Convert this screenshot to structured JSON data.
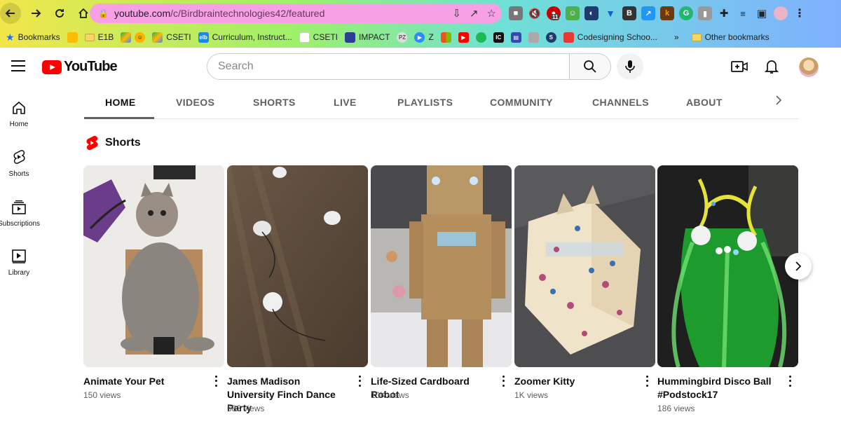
{
  "browser": {
    "url_host": "youtube.com",
    "url_path": "/c/Birdbraintechnologies42/featured",
    "extension_badge": "11",
    "bookmarks": [
      {
        "label": "Bookmarks"
      },
      {
        "label": ""
      },
      {
        "label": "E1B"
      },
      {
        "label": ""
      },
      {
        "label": "CSETI"
      },
      {
        "label": "Curriculum, Instruct..."
      },
      {
        "label": "CSETI"
      },
      {
        "label": "IMPACT"
      },
      {
        "label": "Z"
      },
      {
        "label": "Codesigning Schoo..."
      },
      {
        "label": "Other bookmarks"
      }
    ]
  },
  "masthead": {
    "logo_text": "YouTube",
    "search_placeholder": "Search"
  },
  "guide": [
    {
      "label": "Home"
    },
    {
      "label": "Shorts"
    },
    {
      "label": "Subscriptions"
    },
    {
      "label": "Library"
    }
  ],
  "tabs": [
    "HOME",
    "VIDEOS",
    "SHORTS",
    "LIVE",
    "PLAYLISTS",
    "COMMUNITY",
    "CHANNELS",
    "ABOUT"
  ],
  "shelf": {
    "title": "Shorts",
    "items": [
      {
        "title": "Animate Your Pet",
        "views": "150 views"
      },
      {
        "title": "James Madison University Finch Dance Party",
        "views": "683 views"
      },
      {
        "title": "Life-Sized Cardboard Robot",
        "views": "10K views"
      },
      {
        "title": "Zoomer Kitty",
        "views": "1K views"
      },
      {
        "title": "Hummingbird Disco Ball #Podstock17",
        "views": "186 views"
      }
    ]
  }
}
